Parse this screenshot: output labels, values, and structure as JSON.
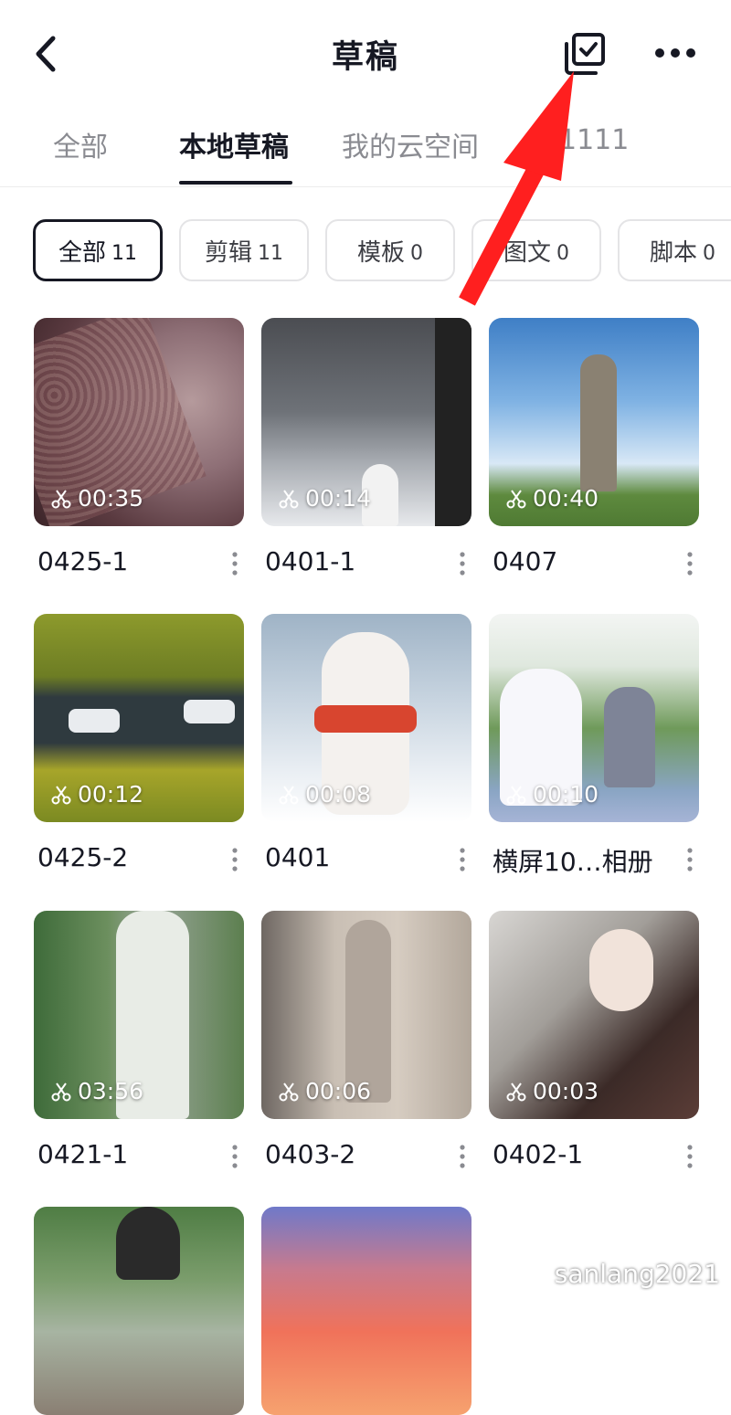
{
  "header": {
    "title": "草稿",
    "back_icon": "back-arrow-icon",
    "select_icon": "multi-select-check-icon",
    "more_icon": "more-dots-icon"
  },
  "tabs": [
    {
      "label": "全部",
      "active": false
    },
    {
      "label": "本地草稿",
      "active": true
    },
    {
      "label": "我的云空间",
      "active": false
    },
    {
      "label": "1111",
      "active": false
    }
  ],
  "filters": [
    {
      "label": "全部",
      "count": "11",
      "active": true
    },
    {
      "label": "剪辑",
      "count": "11",
      "active": false
    },
    {
      "label": "模板",
      "count": "0",
      "active": false
    },
    {
      "label": "图文",
      "count": "0",
      "active": false
    },
    {
      "label": "脚本",
      "count": "0",
      "active": false
    }
  ],
  "drafts": [
    {
      "name": "0425-1",
      "duration": "00:35",
      "theme": "fabric"
    },
    {
      "name": "0401-1",
      "duration": "00:14",
      "theme": "snow-window"
    },
    {
      "name": "0407",
      "duration": "00:40",
      "theme": "statue-sky"
    },
    {
      "name": "0425-2",
      "duration": "00:12",
      "theme": "road-aerial"
    },
    {
      "name": "0401",
      "duration": "00:08",
      "theme": "bunny"
    },
    {
      "name": "横屏10…相册",
      "duration": "00:10",
      "theme": "wedding"
    },
    {
      "name": "0421-1",
      "duration": "03:56",
      "theme": "qipao"
    },
    {
      "name": "0403-2",
      "duration": "00:06",
      "theme": "dance-room"
    },
    {
      "name": "0402-1",
      "duration": "00:03",
      "theme": "swordswoman"
    },
    {
      "name": "",
      "duration": "",
      "theme": "child-park"
    },
    {
      "name": "",
      "duration": "",
      "theme": "sunset"
    }
  ],
  "watermark": "sanlang2021",
  "colors": {
    "primary_text": "#161823",
    "secondary_text": "#8a8b91",
    "annotation_arrow": "#ff1f1f"
  }
}
